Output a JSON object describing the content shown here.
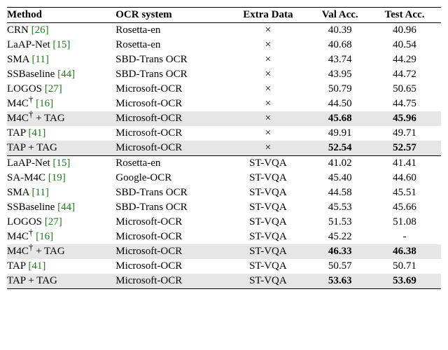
{
  "header": {
    "method": "Method",
    "ocr": "OCR system",
    "extra": "Extra Data",
    "val": "Val Acc.",
    "test": "Test Acc."
  },
  "rows": [
    {
      "method": "CRN",
      "ref": "[26]",
      "dag": false,
      "suffix": "",
      "ocr": "Rosetta-en",
      "extra": "×",
      "val": "40.39",
      "test": "40.96",
      "shade": false,
      "bold": false,
      "sep": false
    },
    {
      "method": "LaAP-Net",
      "ref": "[15]",
      "dag": false,
      "suffix": "",
      "ocr": "Rosetta-en",
      "extra": "×",
      "val": "40.68",
      "test": "40.54",
      "shade": false,
      "bold": false,
      "sep": false
    },
    {
      "method": "SMA",
      "ref": "[11]",
      "dag": false,
      "suffix": "",
      "ocr": "SBD-Trans OCR",
      "extra": "×",
      "val": "43.74",
      "test": "44.29",
      "shade": false,
      "bold": false,
      "sep": false
    },
    {
      "method": "SSBaseline",
      "ref": "[44]",
      "dag": false,
      "suffix": "",
      "ocr": "SBD-Trans OCR",
      "extra": "×",
      "val": "43.95",
      "test": "44.72",
      "shade": false,
      "bold": false,
      "sep": false
    },
    {
      "method": "LOGOS",
      "ref": "[27]",
      "dag": false,
      "suffix": "",
      "ocr": "Microsoft-OCR",
      "extra": "×",
      "val": "50.79",
      "test": "50.65",
      "shade": false,
      "bold": false,
      "sep": false
    },
    {
      "method": "M4C",
      "ref": "[16]",
      "dag": true,
      "suffix": "",
      "ocr": "Microsoft-OCR",
      "extra": "×",
      "val": "44.50",
      "test": "44.75",
      "shade": false,
      "bold": false,
      "sep": false
    },
    {
      "method": "M4C",
      "ref": "",
      "dag": true,
      "suffix": " + TAG",
      "ocr": "Microsoft-OCR",
      "extra": "×",
      "val": "45.68",
      "test": "45.96",
      "shade": true,
      "bold": true,
      "sep": false
    },
    {
      "method": "TAP",
      "ref": "[41]",
      "dag": false,
      "suffix": "",
      "ocr": "Microsoft-OCR",
      "extra": "×",
      "val": "49.91",
      "test": "49.71",
      "shade": false,
      "bold": false,
      "sep": false
    },
    {
      "method": "TAP + TAG",
      "ref": "",
      "dag": false,
      "suffix": "",
      "ocr": "Microsoft-OCR",
      "extra": "×",
      "val": "52.54",
      "test": "52.57",
      "shade": true,
      "bold": true,
      "sep": false
    },
    {
      "method": "LaAP-Net",
      "ref": "[15]",
      "dag": false,
      "suffix": "",
      "ocr": "Rosetta-en",
      "extra": "ST-VQA",
      "val": "41.02",
      "test": "41.41",
      "shade": false,
      "bold": false,
      "sep": true
    },
    {
      "method": "SA-M4C",
      "ref": "[19]",
      "dag": false,
      "suffix": "",
      "ocr": "Google-OCR",
      "extra": "ST-VQA",
      "val": "45.40",
      "test": "44.60",
      "shade": false,
      "bold": false,
      "sep": false
    },
    {
      "method": "SMA",
      "ref": "[11]",
      "dag": false,
      "suffix": "",
      "ocr": "SBD-Trans OCR",
      "extra": "ST-VQA",
      "val": "44.58",
      "test": "45.51",
      "shade": false,
      "bold": false,
      "sep": false
    },
    {
      "method": "SSBaseline",
      "ref": "[44]",
      "dag": false,
      "suffix": "",
      "ocr": "SBD-Trans OCR",
      "extra": "ST-VQA",
      "val": "45.53",
      "test": "45.66",
      "shade": false,
      "bold": false,
      "sep": false
    },
    {
      "method": "LOGOS",
      "ref": "[27]",
      "dag": false,
      "suffix": "",
      "ocr": "Microsoft-OCR",
      "extra": "ST-VQA",
      "val": "51.53",
      "test": "51.08",
      "shade": false,
      "bold": false,
      "sep": false
    },
    {
      "method": "M4C",
      "ref": "[16]",
      "dag": true,
      "suffix": "",
      "ocr": "Microsoft-OCR",
      "extra": "ST-VQA",
      "val": "45.22",
      "test": "-",
      "shade": false,
      "bold": false,
      "sep": false
    },
    {
      "method": "M4C",
      "ref": "",
      "dag": true,
      "suffix": " + TAG",
      "ocr": "Microsoft-OCR",
      "extra": "ST-VQA",
      "val": "46.33",
      "test": "46.38",
      "shade": true,
      "bold": true,
      "sep": false
    },
    {
      "method": "TAP",
      "ref": "[41]",
      "dag": false,
      "suffix": "",
      "ocr": "Microsoft-OCR",
      "extra": "ST-VQA",
      "val": "50.57",
      "test": "50.71",
      "shade": false,
      "bold": false,
      "sep": false
    },
    {
      "method": "TAP + TAG",
      "ref": "",
      "dag": false,
      "suffix": "",
      "ocr": "Microsoft-OCR",
      "extra": "ST-VQA",
      "val": "53.63",
      "test": "53.69",
      "shade": true,
      "bold": true,
      "sep": false
    }
  ]
}
